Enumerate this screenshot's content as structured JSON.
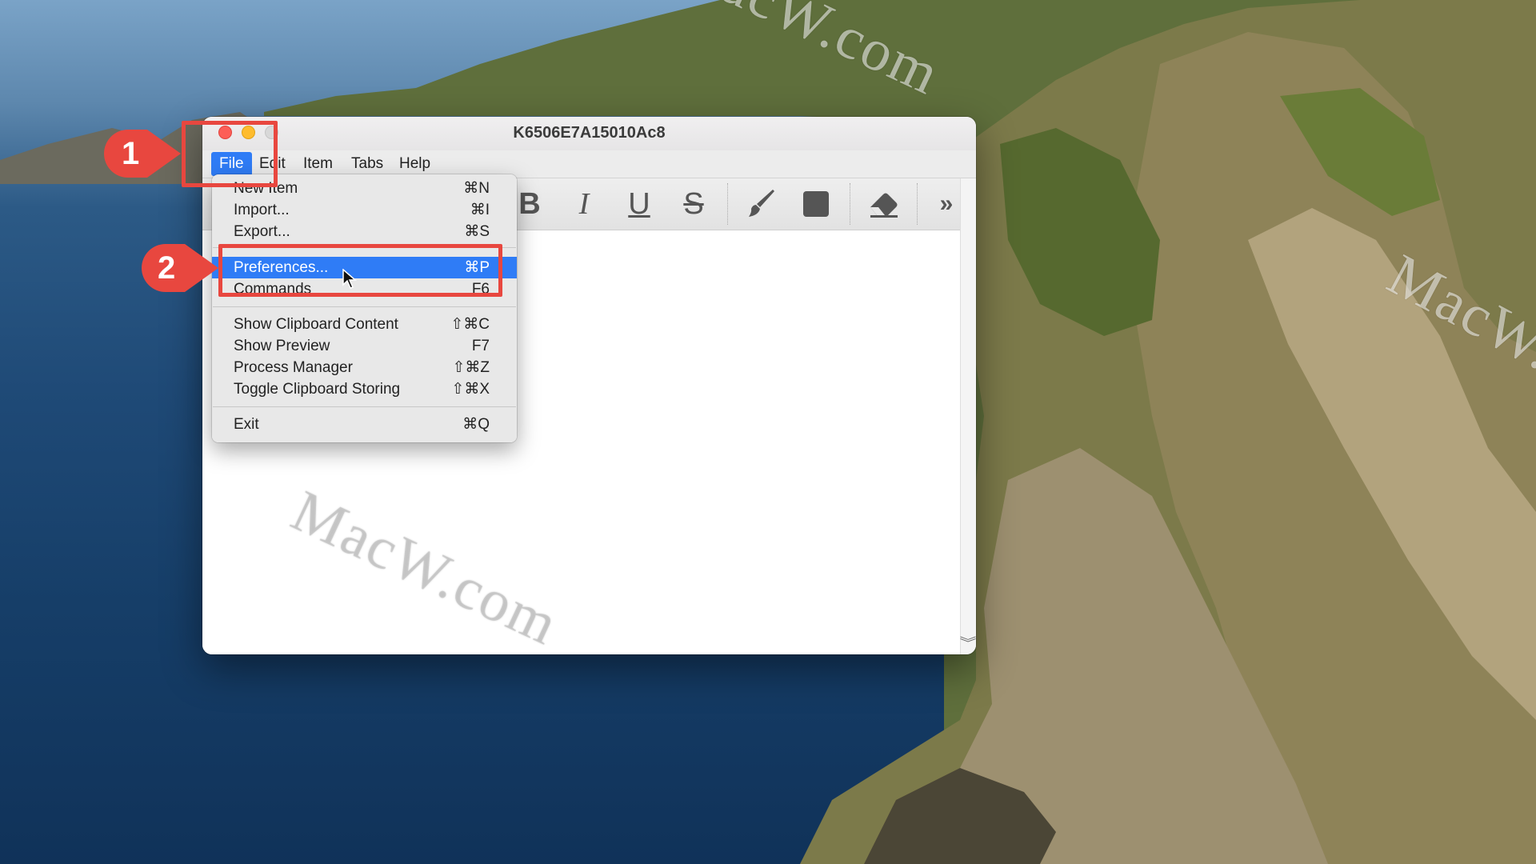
{
  "window": {
    "title": "K6506E7A15010Ac8"
  },
  "menubar": {
    "items": [
      "File",
      "Edit",
      "Item",
      "Tabs",
      "Help"
    ],
    "active": "File"
  },
  "toolbar": {
    "tools": [
      {
        "icon": "bold-icon",
        "glyph": "B"
      },
      {
        "icon": "italic-icon",
        "glyph": "I"
      },
      {
        "icon": "underline-icon",
        "glyph": "U"
      },
      {
        "icon": "strikethrough-icon",
        "glyph": "S"
      },
      {
        "icon": "brush-icon"
      },
      {
        "icon": "fill-square-icon"
      },
      {
        "icon": "eraser-icon"
      },
      {
        "icon": "more-chevron-icon",
        "glyph": "»"
      }
    ]
  },
  "file_menu": {
    "items": [
      {
        "label": "New Item",
        "shortcut": "⌘N"
      },
      {
        "label": "Import...",
        "shortcut": "⌘I"
      },
      {
        "label": "Export...",
        "shortcut": "⌘S"
      },
      {
        "label": "Preferences...",
        "shortcut": "⌘P",
        "selected": true
      },
      {
        "label": "Commands",
        "shortcut": "F6"
      },
      {
        "label": "Show Clipboard Content",
        "shortcut": "⇧⌘C"
      },
      {
        "label": "Show Preview",
        "shortcut": "F7"
      },
      {
        "label": "Process Manager",
        "shortcut": "⇧⌘Z"
      },
      {
        "label": "Toggle Clipboard Storing",
        "shortcut": "⇧⌘X"
      },
      {
        "label": "Exit",
        "shortcut": "⌘Q"
      }
    ]
  },
  "annotations": {
    "step1": "1",
    "step2": "2",
    "color": "#e8473f"
  },
  "watermarks": [
    "MacW.com",
    "MacW.com",
    "MacW.com"
  ],
  "colors": {
    "selection": "#2f7cf6",
    "close": "#fd5e57",
    "minimize": "#febc2e"
  }
}
